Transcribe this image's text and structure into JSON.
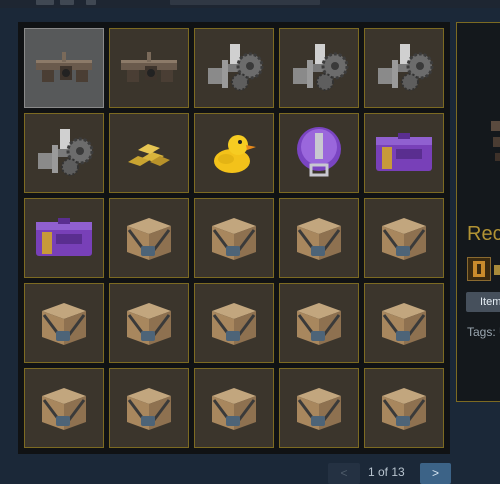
{
  "inventory": {
    "items": [
      {
        "icon": "anvil-icon",
        "selected": true
      },
      {
        "icon": "anvil-icon",
        "selected": false
      },
      {
        "icon": "machinery-icon",
        "selected": false
      },
      {
        "icon": "machinery-icon",
        "selected": false
      },
      {
        "icon": "machinery-icon",
        "selected": false
      },
      {
        "icon": "machinery-icon",
        "selected": false
      },
      {
        "icon": "gold-bars-icon",
        "selected": false
      },
      {
        "icon": "rubber-duck-icon",
        "selected": false
      },
      {
        "icon": "purple-tin-icon",
        "selected": false
      },
      {
        "icon": "purple-case-icon",
        "selected": false
      },
      {
        "icon": "purple-case-icon",
        "selected": false
      },
      {
        "icon": "crate-icon",
        "selected": false
      },
      {
        "icon": "crate-icon",
        "selected": false
      },
      {
        "icon": "crate-icon",
        "selected": false
      },
      {
        "icon": "crate-icon",
        "selected": false
      },
      {
        "icon": "crate-icon",
        "selected": false
      },
      {
        "icon": "crate-icon",
        "selected": false
      },
      {
        "icon": "crate-icon",
        "selected": false
      },
      {
        "icon": "crate-icon",
        "selected": false
      },
      {
        "icon": "crate-icon",
        "selected": false
      },
      {
        "icon": "crate-icon",
        "selected": false
      },
      {
        "icon": "crate-icon",
        "selected": false
      },
      {
        "icon": "crate-icon",
        "selected": false
      },
      {
        "icon": "crate-icon",
        "selected": false
      },
      {
        "icon": "crate-icon",
        "selected": false
      }
    ]
  },
  "details": {
    "title": "Rec",
    "button_label": "Item",
    "tags_label": "Tags: U"
  },
  "pager": {
    "prev_label": "<",
    "info": "1 of 13",
    "next_label": ">"
  },
  "colors": {
    "background": "#1b2838",
    "slot_border": "#7c6a22",
    "title": "#b29334",
    "next_button": "#3c6387"
  }
}
